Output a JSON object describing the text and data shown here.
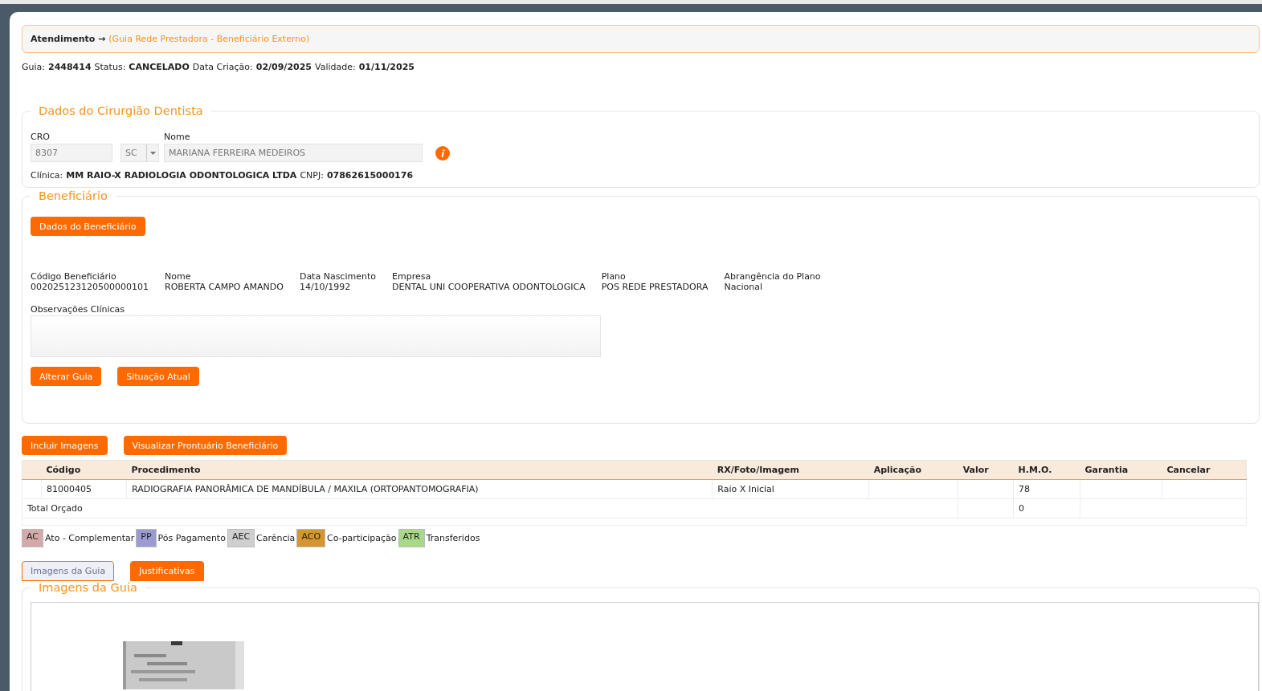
{
  "breadcrumb": {
    "title": "Atendimento →",
    "subtitle": "(Guia Rede Prestadora - Beneficiário Externo)"
  },
  "guide_info": [
    {
      "label": "Guia:",
      "value": "2448414"
    },
    {
      "label": "Status:",
      "value": "CANCELADO"
    },
    {
      "label": "Data Criação:",
      "value": "02/09/2025"
    },
    {
      "label": "Validade:",
      "value": "01/11/2025"
    }
  ],
  "dentist": {
    "legend": "Dados do Cirurgião Dentista",
    "cro_label": "CRO",
    "cro_value": "8307",
    "uf_value": "SC",
    "name_label": "Nome",
    "name_value": "MARIANA FERREIRA MEDEIROS",
    "clinic": [
      {
        "label": "Clínica:",
        "value": "MM RAIO-X RADIOLOGIA ODONTOLOGICA LTDA"
      },
      {
        "label": "CNPJ:",
        "value": "07862615000176"
      }
    ]
  },
  "beneficiary": {
    "legend": "Beneficiário",
    "button": "Dados do Beneficiário",
    "fields": [
      {
        "label": "Código Beneficiário",
        "value": "002025123120500000101"
      },
      {
        "label": "Nome",
        "value": "ROBERTA CAMPO AMANDO"
      },
      {
        "label": "Data Nascimento",
        "value": "14/10/1992"
      },
      {
        "label": "Empresa",
        "value": "DENTAL UNI COOPERATIVA ODONTOLOGICA"
      },
      {
        "label": "Plano",
        "value": "POS REDE PRESTADORA"
      },
      {
        "label": "Abrangência do Plano",
        "value": "Nacional"
      }
    ],
    "observations_label": "Observações Clínicas",
    "buttons": [
      "Alterar Guia",
      "Situação Atual"
    ]
  },
  "actions": [
    "Incluir Imagens",
    "Visualizar Prontuário Beneficiário"
  ],
  "table": {
    "columns": [
      "Código",
      "Procedimento",
      "RX/Foto/Imagem",
      "Aplicação",
      "Valor",
      "H.M.O.",
      "Garantia",
      "Cancelar"
    ],
    "rows": [
      [
        "81000405",
        "RADIOGRAFIA PANORÂMICA DE MANDÍBULA / MAXILA (ORTOPANTOMOGRAFIA)",
        "Raio X Inicial",
        "",
        "",
        "78",
        "",
        ""
      ]
    ],
    "total_label": "Total Orçado",
    "total_hmo": "0"
  },
  "legend_items": [
    {
      "code": "AC",
      "label": "Ato - Complementar",
      "color": "#d4a9a9"
    },
    {
      "code": "PP",
      "label": "Pós Pagamento",
      "color": "#9b9bd1"
    },
    {
      "code": "AEC",
      "label": "Carência",
      "color": "#cfcfcf"
    },
    {
      "code": "ACO",
      "label": "Co-participação",
      "color": "#d4962e"
    },
    {
      "code": "ATR",
      "label": "Transferidos",
      "color": "#a8d88a"
    }
  ],
  "tabs": [
    {
      "label": "Imagens da Guia",
      "selected": true
    },
    {
      "label": "Justificativas",
      "selected": false
    }
  ],
  "images": {
    "legend": "Imagens da Guia"
  }
}
